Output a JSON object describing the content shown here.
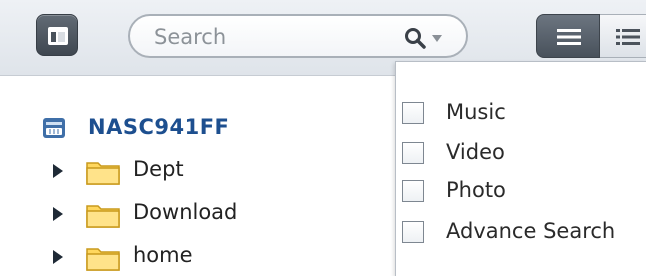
{
  "toolbar": {
    "panel_toggle_icon": "panel-layout-icon",
    "search": {
      "placeholder": "Search",
      "value": ""
    },
    "search_icon": "search-icon",
    "search_options_icon": "chevron-down-icon",
    "view_list_icon": "list-view-icon",
    "view_detail_icon": "detail-list-icon",
    "active_view": "list"
  },
  "tree": {
    "root": {
      "label": "NASC941FF",
      "icon": "nas-server-icon"
    },
    "folders": [
      {
        "label": "Dept",
        "icon": "folder-icon",
        "expand_icon": "expand-arrow-icon"
      },
      {
        "label": "Download",
        "icon": "folder-icon",
        "expand_icon": "expand-arrow-icon"
      },
      {
        "label": "home",
        "icon": "folder-icon",
        "expand_icon": "expand-arrow-icon"
      }
    ]
  },
  "search_menu": {
    "items": [
      {
        "label": "Music",
        "checked": false
      },
      {
        "label": "Video",
        "checked": false
      },
      {
        "label": "Photo",
        "checked": false
      },
      {
        "label": "Advance Search",
        "checked": false
      }
    ]
  },
  "colors": {
    "root_label": "#1d4f8f",
    "folder_fill": "#ffd75e",
    "folder_stroke": "#c99a1d",
    "button_dark": "#48515b"
  }
}
